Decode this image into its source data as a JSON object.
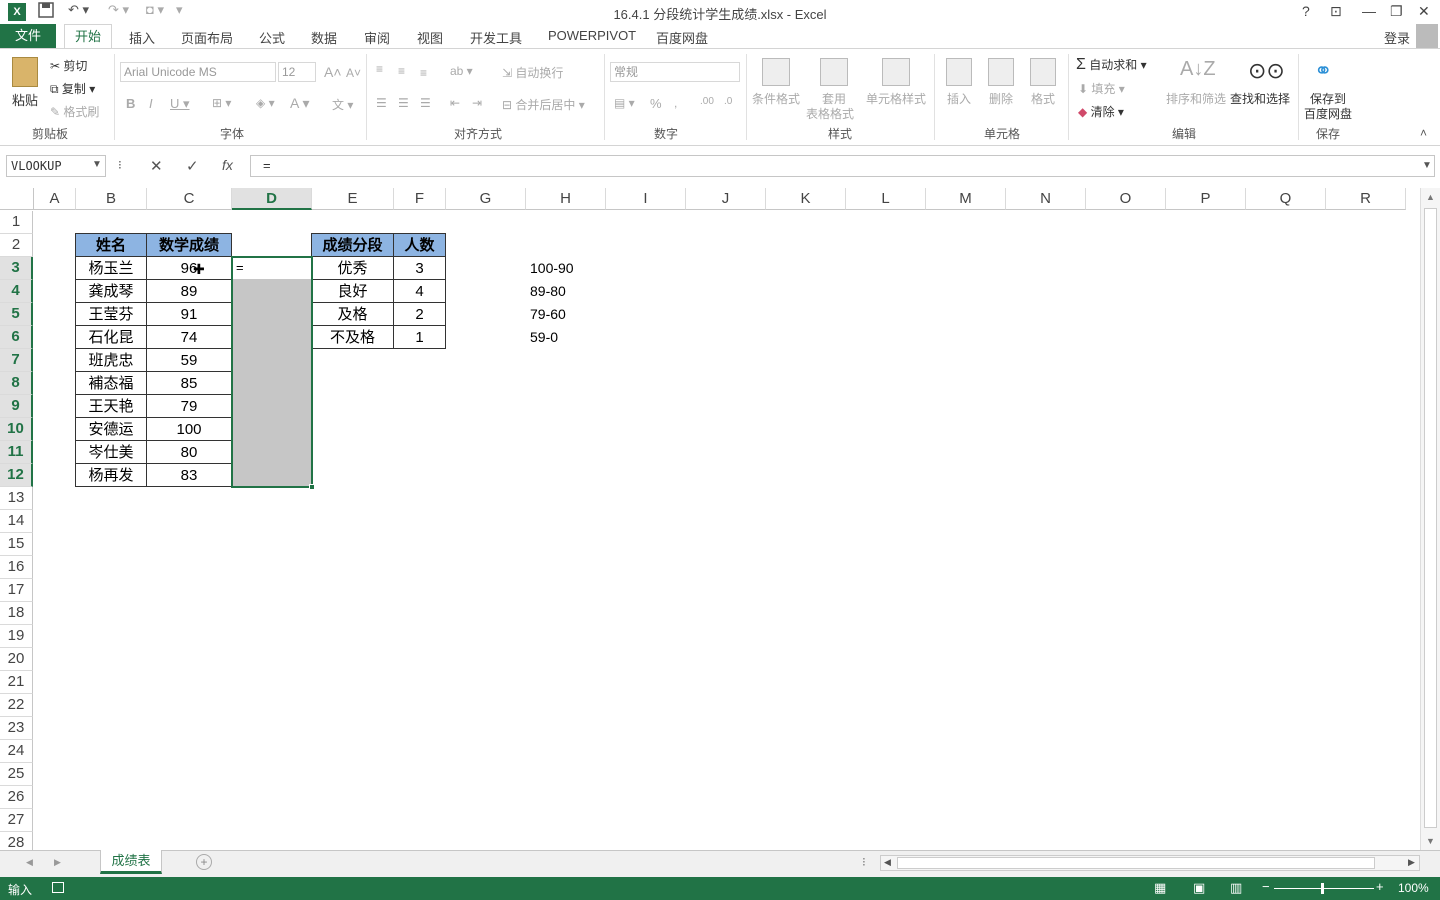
{
  "window": {
    "title": "16.4.1 分段统计学生成绩.xlsx - Excel",
    "help": "?",
    "login": "登录"
  },
  "tabs": {
    "file": "文件",
    "home": "开始",
    "insert": "插入",
    "layout": "页面布局",
    "formulas": "公式",
    "data": "数据",
    "review": "审阅",
    "view": "视图",
    "developer": "开发工具",
    "powerpivot": "POWERPIVOT",
    "baidu": "百度网盘"
  },
  "ribbon": {
    "clipboard": {
      "paste": "粘贴",
      "cut": "剪切",
      "copy": "复制",
      "format_painter": "格式刷",
      "group": "剪贴板"
    },
    "font": {
      "name": "Arial Unicode MS",
      "size": "12",
      "group": "字体"
    },
    "align": {
      "wrap": "自动换行",
      "merge": "合并后居中",
      "group": "对齐方式"
    },
    "number": {
      "format": "常规",
      "group": "数字"
    },
    "styles": {
      "cond": "条件格式",
      "table_fmt1": "套用",
      "table_fmt2": "表格格式",
      "cell_styles": "单元格样式",
      "group": "样式"
    },
    "cells": {
      "insert": "插入",
      "delete": "删除",
      "format": "格式",
      "group": "单元格"
    },
    "editing": {
      "autosum": "自动求和",
      "fill": "填充",
      "clear": "清除",
      "sort": "排序和筛选",
      "find": "查找和选择",
      "group": "编辑"
    },
    "save": {
      "line1": "保存到",
      "line2": "百度网盘",
      "group": "保存"
    }
  },
  "formula_bar": {
    "name_box": "VLOOKUP",
    "formula": "="
  },
  "columns": [
    "A",
    "B",
    "C",
    "D",
    "E",
    "F",
    "G",
    "H",
    "I",
    "J",
    "K",
    "L",
    "M",
    "N",
    "O",
    "P",
    "Q",
    "R"
  ],
  "rows": [
    "1",
    "2",
    "3",
    "4",
    "5",
    "6",
    "7",
    "8",
    "9",
    "10",
    "11",
    "12",
    "13",
    "14",
    "15",
    "16",
    "17",
    "18",
    "19",
    "20",
    "21",
    "22",
    "23",
    "24",
    "25",
    "26",
    "27",
    "28"
  ],
  "table1": {
    "headers": [
      "姓名",
      "数学成绩"
    ],
    "rows": [
      [
        "杨玉兰",
        "96"
      ],
      [
        "龚成琴",
        "89"
      ],
      [
        "王莹芬",
        "91"
      ],
      [
        "石化昆",
        "74"
      ],
      [
        "班虎忠",
        "59"
      ],
      [
        "補态福",
        "85"
      ],
      [
        "王天艳",
        "79"
      ],
      [
        "安德运",
        "100"
      ],
      [
        "岑仕美",
        "80"
      ],
      [
        "杨再发",
        "83"
      ]
    ]
  },
  "active_cell_text": "=",
  "table2": {
    "headers": [
      "成绩分段",
      "人数"
    ],
    "rows": [
      [
        "优秀",
        "3"
      ],
      [
        "良好",
        "4"
      ],
      [
        "及格",
        "2"
      ],
      [
        "不及格",
        "1"
      ]
    ]
  },
  "ranges": [
    "100-90",
    "89-80",
    "79-60",
    "59-0"
  ],
  "sheet": {
    "tab": "成绩表"
  },
  "status": {
    "mode": "输入",
    "zoom": "100%"
  }
}
